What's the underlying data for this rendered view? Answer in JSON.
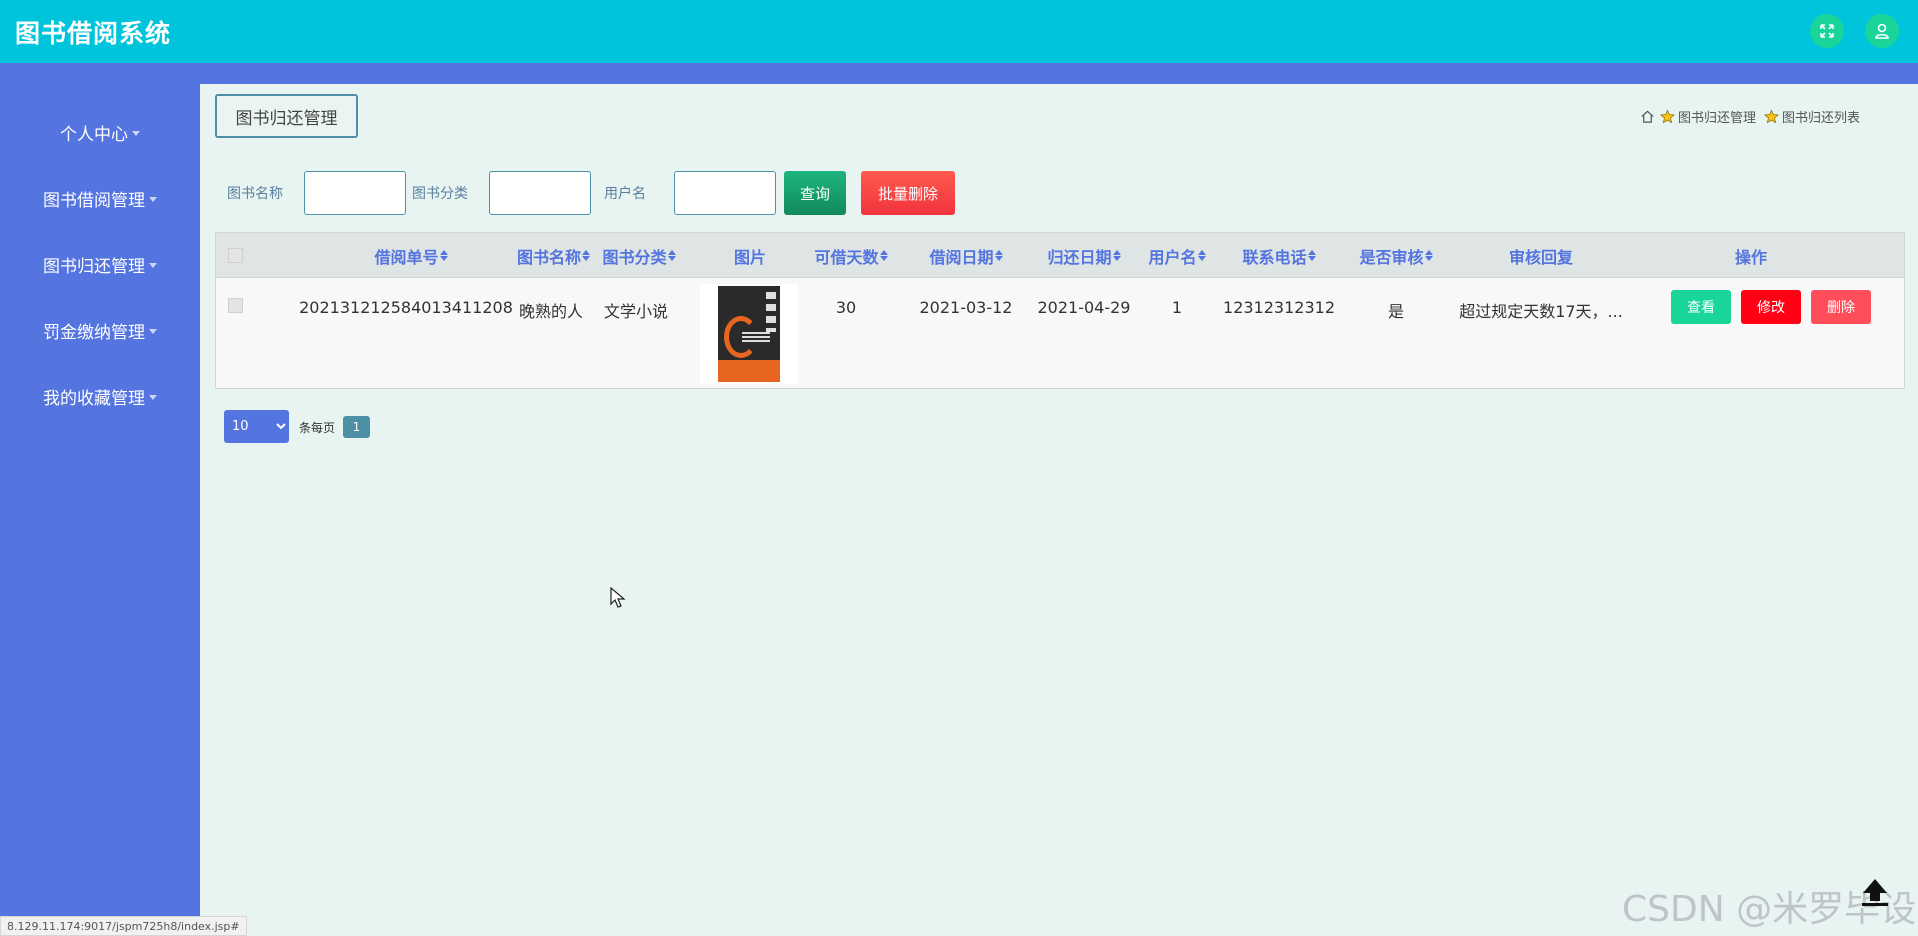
{
  "header": {
    "app_title": "图书借阅系统",
    "fullscreen_icon": "fullscreen-icon",
    "user_icon": "user-icon"
  },
  "sidebar": {
    "items": [
      {
        "label": "个人中心"
      },
      {
        "label": "图书借阅管理"
      },
      {
        "label": "图书归还管理"
      },
      {
        "label": "罚金缴纳管理"
      },
      {
        "label": "我的收藏管理"
      }
    ]
  },
  "page": {
    "title": "图书归还管理",
    "breadcrumb": [
      "图书归还管理",
      "图书归还列表"
    ]
  },
  "search": {
    "book_name_label": "图书名称",
    "book_name_value": "",
    "category_label": "图书分类",
    "category_value": "",
    "username_label": "用户名",
    "username_value": "",
    "query_label": "查询",
    "batch_delete_label": "批量删除"
  },
  "table": {
    "columns": [
      "借阅单号",
      "图书名称",
      "图书分类",
      "图片",
      "可借天数",
      "借阅日期",
      "归还日期",
      "用户名",
      "联系电话",
      "是否审核",
      "审核回复",
      "操作"
    ],
    "rows": [
      {
        "order_no": "202131212584013411208",
        "book_name": "晚熟的人",
        "category": "文学小说",
        "days": "30",
        "borrow_date": "2021-03-12",
        "return_date": "2021-04-29",
        "username": "1",
        "phone": "12312312312",
        "reviewed": "是",
        "reply": "超过规定天数17天，...",
        "actions": {
          "view": "查看",
          "edit": "修改",
          "delete": "删除"
        }
      }
    ]
  },
  "pagination": {
    "page_size": "10",
    "per_page_label": "条每页",
    "current_page": "1"
  },
  "status_url": "8.129.11.174:9017/jspm725h8/index.jsp#",
  "watermark": "CSDN @米罗毕设",
  "colors": {
    "topbar": "#00c4dc",
    "sidebar": "#5474e0",
    "header_text": "#5474e0",
    "query_btn": "#128a5e",
    "delete_btn": "#f1333d",
    "view_btn": "#19d59a",
    "edit_btn": "#ff0015"
  }
}
